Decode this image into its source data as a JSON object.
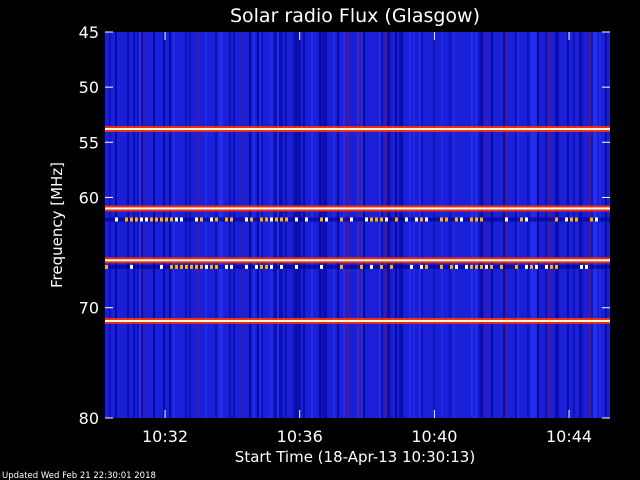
{
  "chart_data": {
    "type": "heatmap",
    "title": "Solar radio Flux (Glasgow)",
    "xlabel": "Start Time (18-Apr-13 10:30:13)",
    "ylabel": "Frequency [MHz]",
    "x_range": [
      "10:30:13",
      "10:45:13"
    ],
    "y_range": [
      45,
      80
    ],
    "y_ticks": [
      45,
      50,
      55,
      60,
      70,
      80
    ],
    "y_tick_labels": [
      "45",
      "50",
      "55",
      "60",
      "70",
      "80"
    ],
    "x_ticks": [
      "10:32",
      "10:36",
      "10:40",
      "10:44"
    ],
    "colormap": [
      "#00008b",
      "#1a20d8",
      "#8b0000",
      "#ff3000",
      "#ffb000",
      "#ffffe0"
    ],
    "background_color": "#1a20d8",
    "interference_bands_mhz": [
      {
        "freq": 53.8,
        "intensity": "high"
      },
      {
        "freq": 61.0,
        "intensity": "high"
      },
      {
        "freq": 62.0,
        "intensity": "intermittent"
      },
      {
        "freq": 65.7,
        "intensity": "high"
      },
      {
        "freq": 66.3,
        "intensity": "intermittent"
      },
      {
        "freq": 71.2,
        "intensity": "high"
      }
    ]
  },
  "footer_text": "Updated Wed Feb 21 22:30:01 2018"
}
